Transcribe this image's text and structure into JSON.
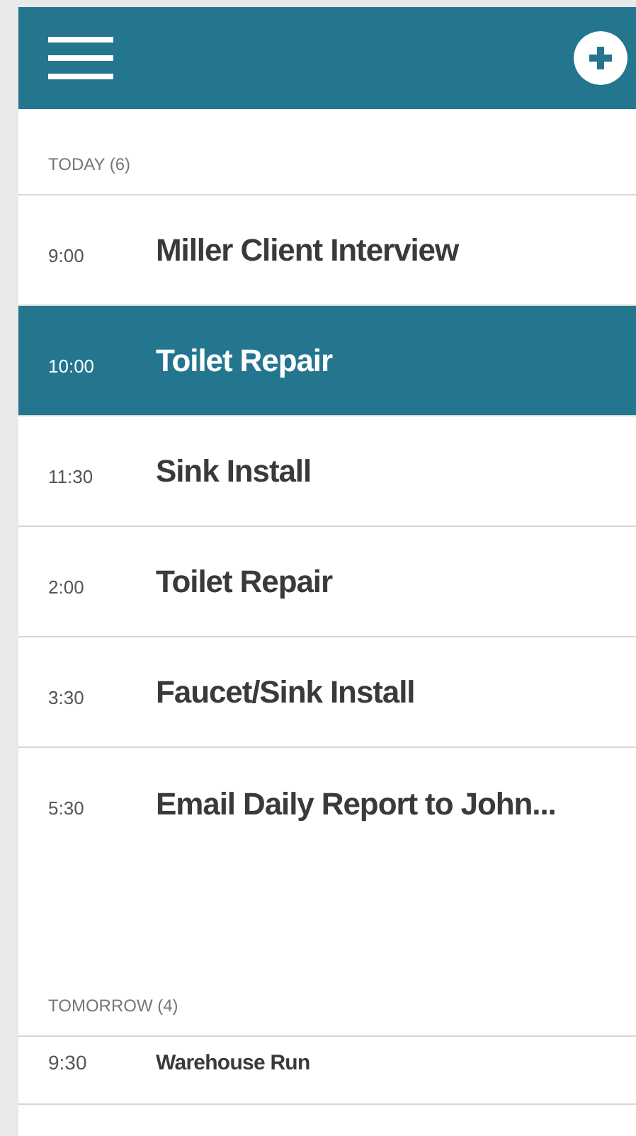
{
  "sections": [
    {
      "label": "TODAY (6)",
      "kind": "today",
      "items": [
        {
          "time": "9:00",
          "title": "Miller Client Interview",
          "selected": false
        },
        {
          "time": "10:00",
          "title": "Toilet Repair",
          "selected": true
        },
        {
          "time": "11:30",
          "title": "Sink Install",
          "selected": false
        },
        {
          "time": "2:00",
          "title": "Toilet Repair",
          "selected": false
        },
        {
          "time": "3:30",
          "title": "Faucet/Sink Install",
          "selected": false
        },
        {
          "time": "5:30",
          "title": "Email Daily Report to John...",
          "selected": false
        }
      ]
    },
    {
      "label": "TOMORROW (4)",
      "kind": "tomorrow",
      "items": [
        {
          "time": "9:30",
          "title": "Warehouse Run",
          "selected": false
        }
      ]
    }
  ]
}
